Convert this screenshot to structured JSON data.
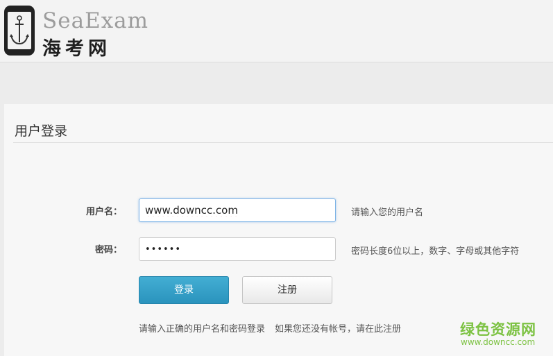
{
  "header": {
    "logo_en": "SeaExam",
    "logo_cn": "海考网"
  },
  "login": {
    "title": "用户登录",
    "username_label": "用户名：",
    "username_value": "www.downcc.com",
    "username_hint": "请输入您的用户名",
    "password_label": "密码：",
    "password_value": "••••••",
    "password_hint": "密码长度6位以上，数字、字母或其他字符",
    "login_button": "登录",
    "register_button": "注册",
    "footer_note": "请输入正确的用户名和密码登录",
    "register_link": "如果您还没有帐号，请在此注册"
  },
  "watermark": {
    "cn": "绿色资源网",
    "url": "www.downcc.com"
  }
}
